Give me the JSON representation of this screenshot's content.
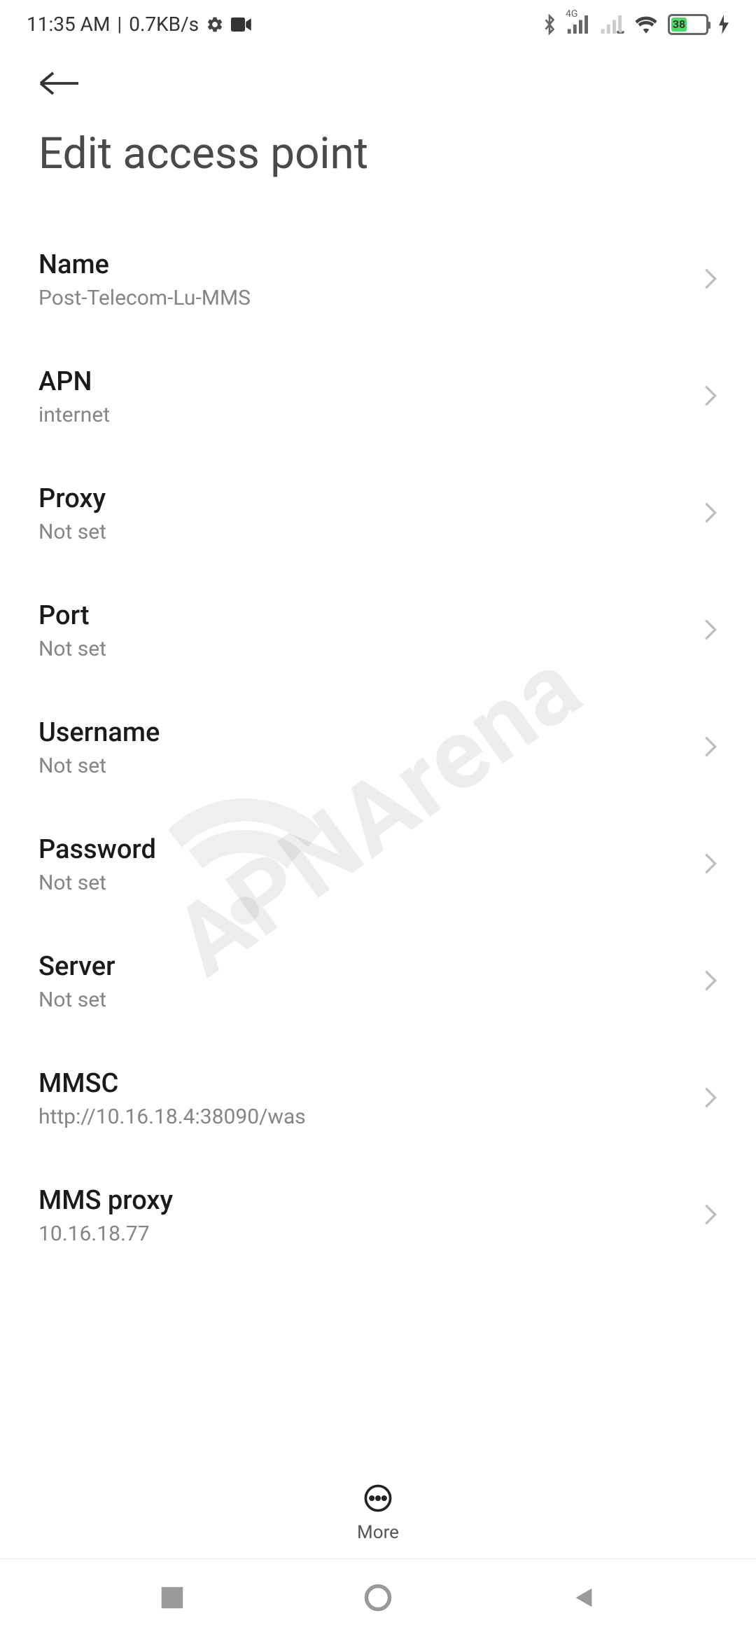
{
  "status_bar": {
    "time": "11:35 AM",
    "data_rate": "0.7KB/s",
    "battery_percent": "38",
    "signal_label": "4G"
  },
  "page": {
    "title": "Edit access point"
  },
  "settings": [
    {
      "label": "Name",
      "value": "Post-Telecom-Lu-MMS"
    },
    {
      "label": "APN",
      "value": "internet"
    },
    {
      "label": "Proxy",
      "value": "Not set"
    },
    {
      "label": "Port",
      "value": "Not set"
    },
    {
      "label": "Username",
      "value": "Not set"
    },
    {
      "label": "Password",
      "value": "Not set"
    },
    {
      "label": "Server",
      "value": "Not set"
    },
    {
      "label": "MMSC",
      "value": "http://10.16.18.4:38090/was"
    },
    {
      "label": "MMS proxy",
      "value": "10.16.18.77"
    }
  ],
  "bottom_action": {
    "label": "More"
  },
  "watermark": "APNArena"
}
